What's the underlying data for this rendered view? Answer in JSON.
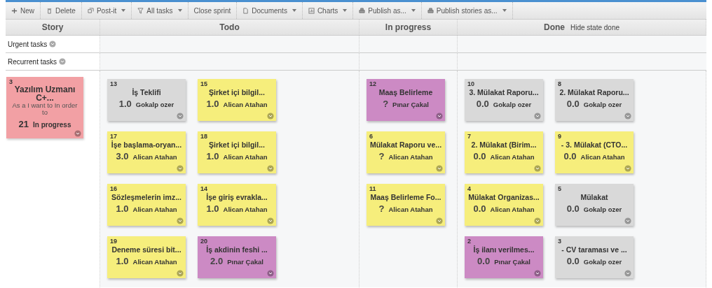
{
  "toolbar": [
    {
      "label": "New",
      "kind": "plus",
      "dropdown": false
    },
    {
      "label": "Delete",
      "kind": "trash",
      "dropdown": false
    },
    {
      "label": "Post-it",
      "kind": "postit",
      "dropdown": true
    },
    {
      "label": "All tasks",
      "kind": "filter",
      "dropdown": true
    },
    {
      "label": "Close sprint",
      "kind": "plain",
      "dropdown": false
    },
    {
      "label": "Documents",
      "kind": "document",
      "dropdown": true
    },
    {
      "label": "Charts",
      "kind": "chart",
      "dropdown": true
    },
    {
      "label": "Publish as...",
      "kind": "printer",
      "dropdown": true
    },
    {
      "label": "Publish stories as...",
      "kind": "printer",
      "dropdown": true
    }
  ],
  "columns": [
    {
      "title": "Story"
    },
    {
      "title": "Todo"
    },
    {
      "title": "In progress"
    },
    {
      "title": "Done",
      "link": "Hide state done"
    }
  ],
  "swimlanes": [
    {
      "label": "Urgent tasks"
    },
    {
      "label": "Recurrent tasks"
    }
  ],
  "story": {
    "number": "3",
    "title": "Yazılım Uzmanı C+...",
    "description": "As a I want to In order to",
    "points": "21",
    "state": "In progress",
    "color": "#f2a0a4"
  },
  "todo": [
    {
      "number": "13",
      "title": "İş Teklifi",
      "estimate": "1.0",
      "assignee": "Gokalp ozer",
      "color": "#d9d9d9"
    },
    {
      "number": "15",
      "title": "Şirket içi bilgil...",
      "estimate": "1.0",
      "assignee": "Alican Atahan",
      "color": "#f6ee7c"
    },
    {
      "number": "17",
      "title": "İşe başlama-oryan...",
      "estimate": "3.0",
      "assignee": "Alican Atahan",
      "color": "#f6ee7c"
    },
    {
      "number": "18",
      "title": "Şirket içi bilgil...",
      "estimate": "1.0",
      "assignee": "Alican Atahan",
      "color": "#f6ee7c"
    },
    {
      "number": "16",
      "title": "Sözleşmelerin imz...",
      "estimate": "1.0",
      "assignee": "Alican Atahan",
      "color": "#f6ee7c"
    },
    {
      "number": "14",
      "title": "İşe giriş evrakla...",
      "estimate": "1.0",
      "assignee": "Alican Atahan",
      "color": "#f6ee7c"
    },
    {
      "number": "19",
      "title": "Deneme süresi bit...",
      "estimate": "1.0",
      "assignee": "Alican Atahan",
      "color": "#f6ee7c"
    },
    {
      "number": "20",
      "title": "İş akdinin feshi ...",
      "estimate": "2.0",
      "assignee": "Pınar Çakal",
      "color": "#cc8ac4"
    }
  ],
  "in_progress": [
    {
      "number": "12",
      "title": "Maaş Belirleme",
      "estimate": "?",
      "assignee": "Pınar Çakal",
      "color": "#cc8ac4"
    },
    {
      "number": "6",
      "title": "Mülakat Raporu ve...",
      "estimate": "?",
      "assignee": "Alican Atahan",
      "color": "#f6ee7c"
    },
    {
      "number": "11",
      "title": "Maaş Belirleme Fo...",
      "estimate": "?",
      "assignee": "Alican Atahan",
      "color": "#f6ee7c"
    }
  ],
  "done": [
    {
      "number": "10",
      "title": "3. Mülakat Raporu...",
      "estimate": "0.0",
      "assignee": "Gokalp ozer",
      "color": "#d9d9d9"
    },
    {
      "number": "8",
      "title": "2. Mülakat Raporu...",
      "estimate": "0.0",
      "assignee": "Gokalp ozer",
      "color": "#d9d9d9"
    },
    {
      "number": "7",
      "title": "2. Mülakat (Birim...",
      "estimate": "0.0",
      "assignee": "Alican Atahan",
      "color": "#f6ee7c"
    },
    {
      "number": "9",
      "title": "- 3. Mülakat (CTO...",
      "estimate": "0.0",
      "assignee": "Alican Atahan",
      "color": "#f6ee7c"
    },
    {
      "number": "4",
      "title": "Mülakat Organizas...",
      "estimate": "0.0",
      "assignee": "Alican Atahan",
      "color": "#f6ee7c"
    },
    {
      "number": "5",
      "title": "Mülakat",
      "estimate": "0.0",
      "assignee": "Gokalp ozer",
      "color": "#d9d9d9"
    },
    {
      "number": "2",
      "title": "İş ilanı verilmes...",
      "estimate": "0.0",
      "assignee": "Pınar Çakal",
      "color": "#cc8ac4"
    },
    {
      "number": "3",
      "title": "- CV taraması ve ...",
      "estimate": "0.0",
      "assignee": "Gokalp ozer",
      "color": "#d9d9d9"
    }
  ]
}
